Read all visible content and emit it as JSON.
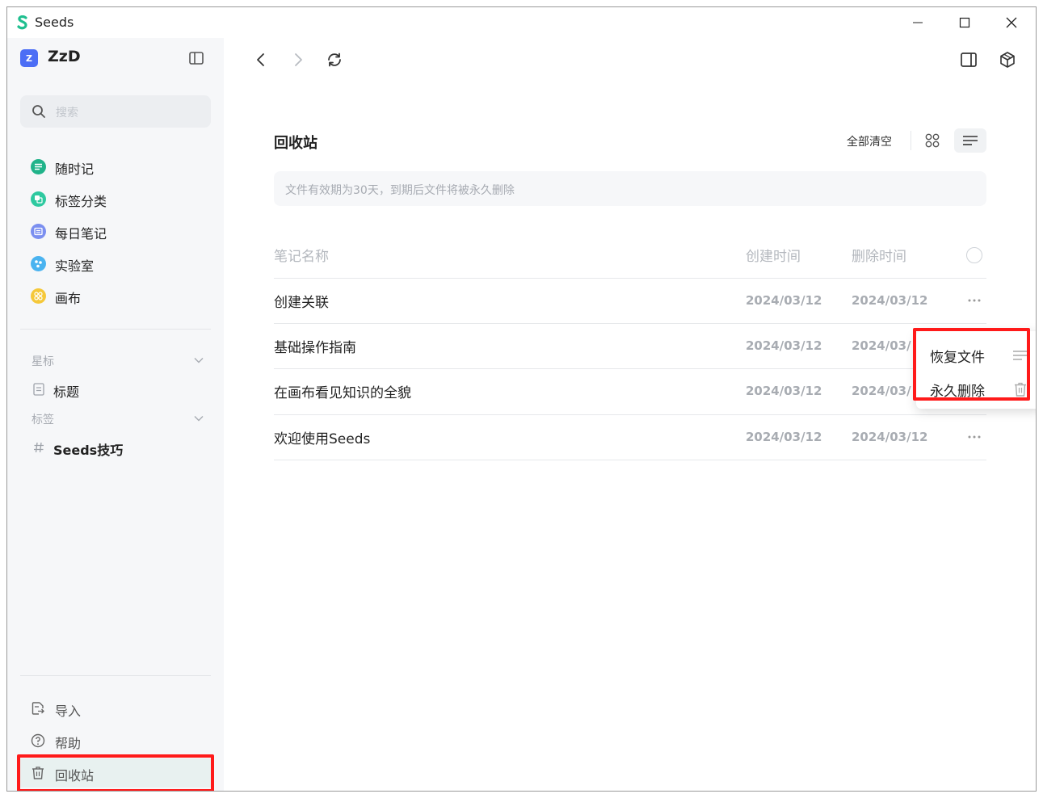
{
  "window": {
    "title": "Seeds",
    "colors": {
      "brand": "#1fbf8f",
      "accent": "#4c6ef5",
      "highlight": "#ff1a1a"
    }
  },
  "sidebar": {
    "workspace": {
      "avatar_letter": "Z",
      "name": "ZzD"
    },
    "search": {
      "placeholder": "搜索"
    },
    "items": [
      {
        "label": "随时记",
        "icon": "note-icon",
        "color": "#20b38a"
      },
      {
        "label": "标签分类",
        "icon": "tag-category-icon",
        "color": "#2ec9a0"
      },
      {
        "label": "每日笔记",
        "icon": "daily-note-icon",
        "color": "#7b8ff0"
      },
      {
        "label": "实验室",
        "icon": "lab-icon",
        "color": "#4ab3f0"
      },
      {
        "label": "画布",
        "icon": "canvas-icon",
        "color": "#f5c83a"
      }
    ],
    "starred": {
      "label": "星标",
      "items": [
        {
          "label": "标题",
          "icon": "document-icon"
        }
      ]
    },
    "tags": {
      "label": "标签",
      "items": [
        {
          "label": "Seeds技巧",
          "icon": "hash-icon"
        }
      ]
    },
    "bottom": [
      {
        "label": "导入",
        "icon": "import-icon"
      },
      {
        "label": "帮助",
        "icon": "help-icon"
      },
      {
        "label": "回收站",
        "icon": "trash-icon"
      }
    ]
  },
  "main": {
    "title": "回收站",
    "clear_all": "全部清空",
    "notice": "文件有效期为30天，到期后文件将被永久删除",
    "columns": {
      "name": "笔记名称",
      "created": "创建时间",
      "deleted": "删除时间"
    },
    "rows": [
      {
        "name": "创建关联",
        "created": "2024/03/12",
        "deleted": "2024/03/12"
      },
      {
        "name": "基础操作指南",
        "created": "2024/03/12",
        "deleted": "2024/03/"
      },
      {
        "name": "在画布看见知识的全貌",
        "created": "2024/03/12",
        "deleted": "2024/03/"
      },
      {
        "name": "欢迎使用Seeds",
        "created": "2024/03/12",
        "deleted": "2024/03/12"
      }
    ]
  },
  "context_menu": {
    "items": [
      {
        "label": "恢复文件",
        "icon": "restore-icon"
      },
      {
        "label": "永久删除",
        "icon": "trash-icon"
      }
    ]
  }
}
